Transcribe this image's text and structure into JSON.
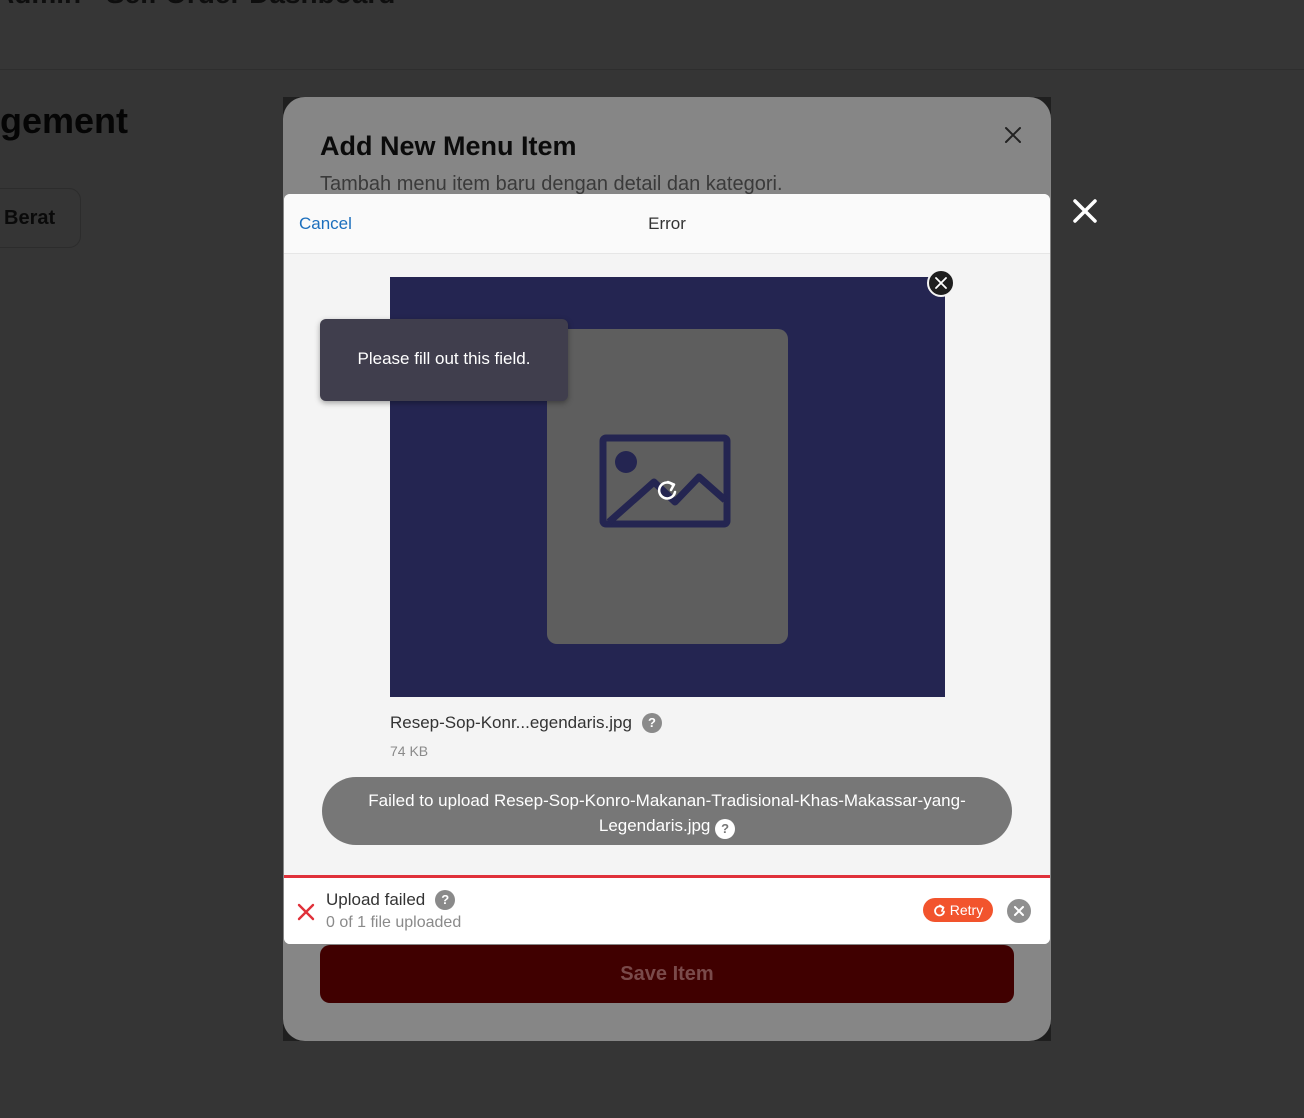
{
  "background": {
    "app_title": "Admin - Self Order Dashboard",
    "page_title": "gement",
    "filter_chip": "Berat"
  },
  "menu_modal": {
    "title": "Add New Menu Item",
    "subtitle": "Tambah menu item baru dengan detail dan kategori.",
    "close_icon": "close-icon",
    "save_button": "Save Item"
  },
  "upload_dashboard": {
    "cancel_label": "Cancel",
    "title": "Error",
    "close_icon": "close-icon",
    "tooltip": "Please fill out this field.",
    "file": {
      "name": "Resep-Sop-Konr...egendaris.jpg",
      "size": "74 KB",
      "help": "?"
    },
    "error_message": "Failed to upload Resep-Sop-Konro-Makanan-Tradisional-Khas-Makassar-yang-Legendaris.jpg",
    "error_help": "?",
    "status": {
      "title": "Upload failed",
      "help": "?",
      "subtitle": "0 of 1 file uploaded",
      "retry_label": "Retry"
    }
  },
  "colors": {
    "accent_link": "#1c6fbd",
    "error_red": "#e0313a",
    "retry_orange": "#f2542d",
    "preview_bg": "#242551",
    "save_button_bg": "#400000"
  }
}
